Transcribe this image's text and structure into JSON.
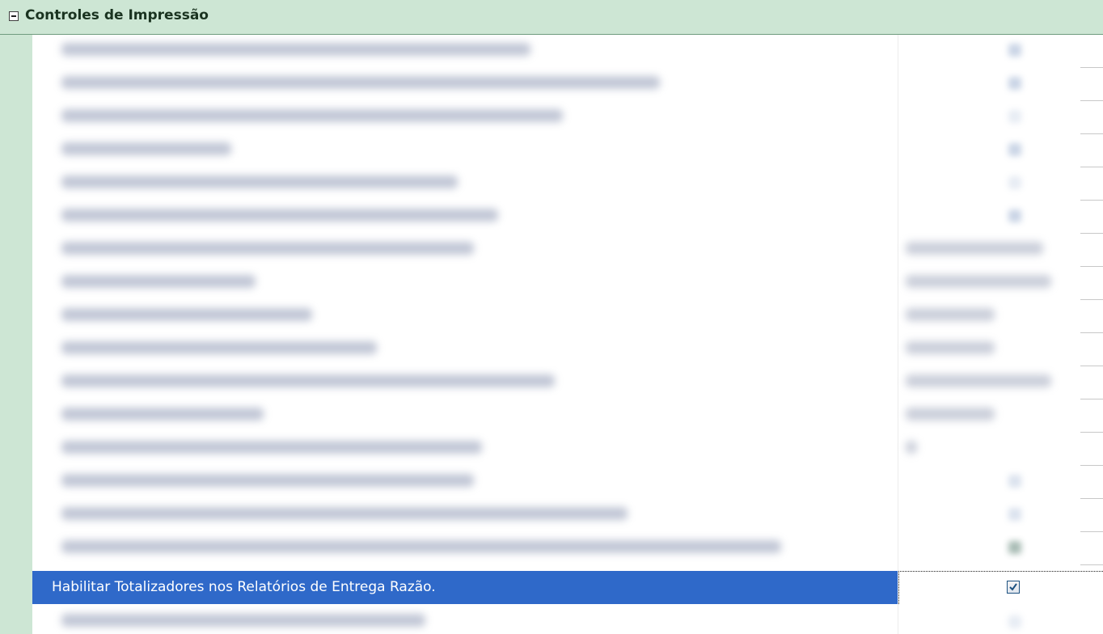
{
  "category": {
    "title": "Controles de Impressão",
    "collapse_icon": "minus-box-icon"
  },
  "selected_property": {
    "label": "Habilitar Totalizadores nos Relatórios de Entrega Razão.",
    "checked": true,
    "checkbox_icon": "checkbox-checked-icon"
  },
  "colors": {
    "category_background": "#cde6d4",
    "selection": "#2f69c9",
    "selection_text": "#ffffff",
    "checkmark": "#1c5180"
  }
}
